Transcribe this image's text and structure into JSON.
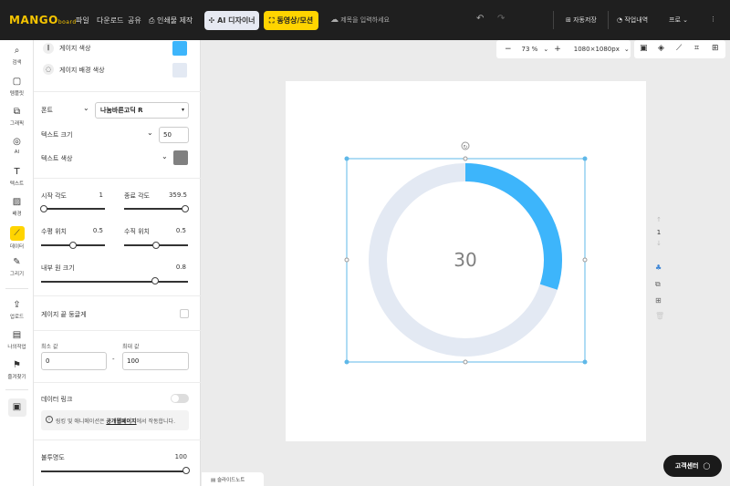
{
  "topbar": {
    "logo_main": "MANGO",
    "logo_sub": "board",
    "menus": [
      "파일",
      "다운로드",
      "공유"
    ],
    "print_label": "인쇄물 제작",
    "ai_label": "AI 디자이너",
    "video_label": "동영상/모션",
    "title_placeholder": "제목을 입력하세요",
    "autosave_label": "자동저장",
    "history_label": "작업내역",
    "plan_label": "프로"
  },
  "leftnav": {
    "items": [
      "검색",
      "템플릿",
      "그래픽",
      "AI",
      "텍스트",
      "배경",
      "데이터",
      "그리기",
      "업로드",
      "나의작업",
      "즐겨찾기"
    ]
  },
  "panel": {
    "gauge_color_label": "게이지 색상",
    "gauge_bg_color_label": "게이지 배경 색상",
    "font_label": "폰트",
    "font_value": "나눔바른고딕 R",
    "text_size_label": "텍스트 크기",
    "text_size_value": "50",
    "text_color_label": "텍스트 색상",
    "start_angle_label": "시작 각도",
    "start_angle_value": "1",
    "end_angle_label": "종료 각도",
    "end_angle_value": "359.5",
    "h_pos_label": "수평 위치",
    "h_pos_value": "0.5",
    "v_pos_label": "수직 위치",
    "v_pos_value": "0.5",
    "inner_radius_label": "내부 원 크기",
    "inner_radius_value": "0.8",
    "round_ends_label": "게이지 끝 둥글게",
    "min_label": "최소 값",
    "min_value": "0",
    "max_label": "최대 값",
    "max_value": "100",
    "range_sep": "-",
    "data_link_label": "데이터 링크",
    "note_prefix": "링킹 및 애니메이션은 ",
    "note_link": "공개웹페이지",
    "note_suffix": "에서 작동합니다.",
    "opacity_label": "불투명도",
    "opacity_value": "100"
  },
  "colors": {
    "gauge": "#3db5fb",
    "gauge_bg": "#e3e9f3",
    "text": "#808080",
    "accent": "#ffd400"
  },
  "canvas": {
    "zoom": "73 %",
    "size": "1080×1080px",
    "page_number": "1",
    "gauge_value": 30,
    "gauge_text": "30",
    "slide_note_label": "슬라이드노트",
    "help_label": "고객센터"
  }
}
